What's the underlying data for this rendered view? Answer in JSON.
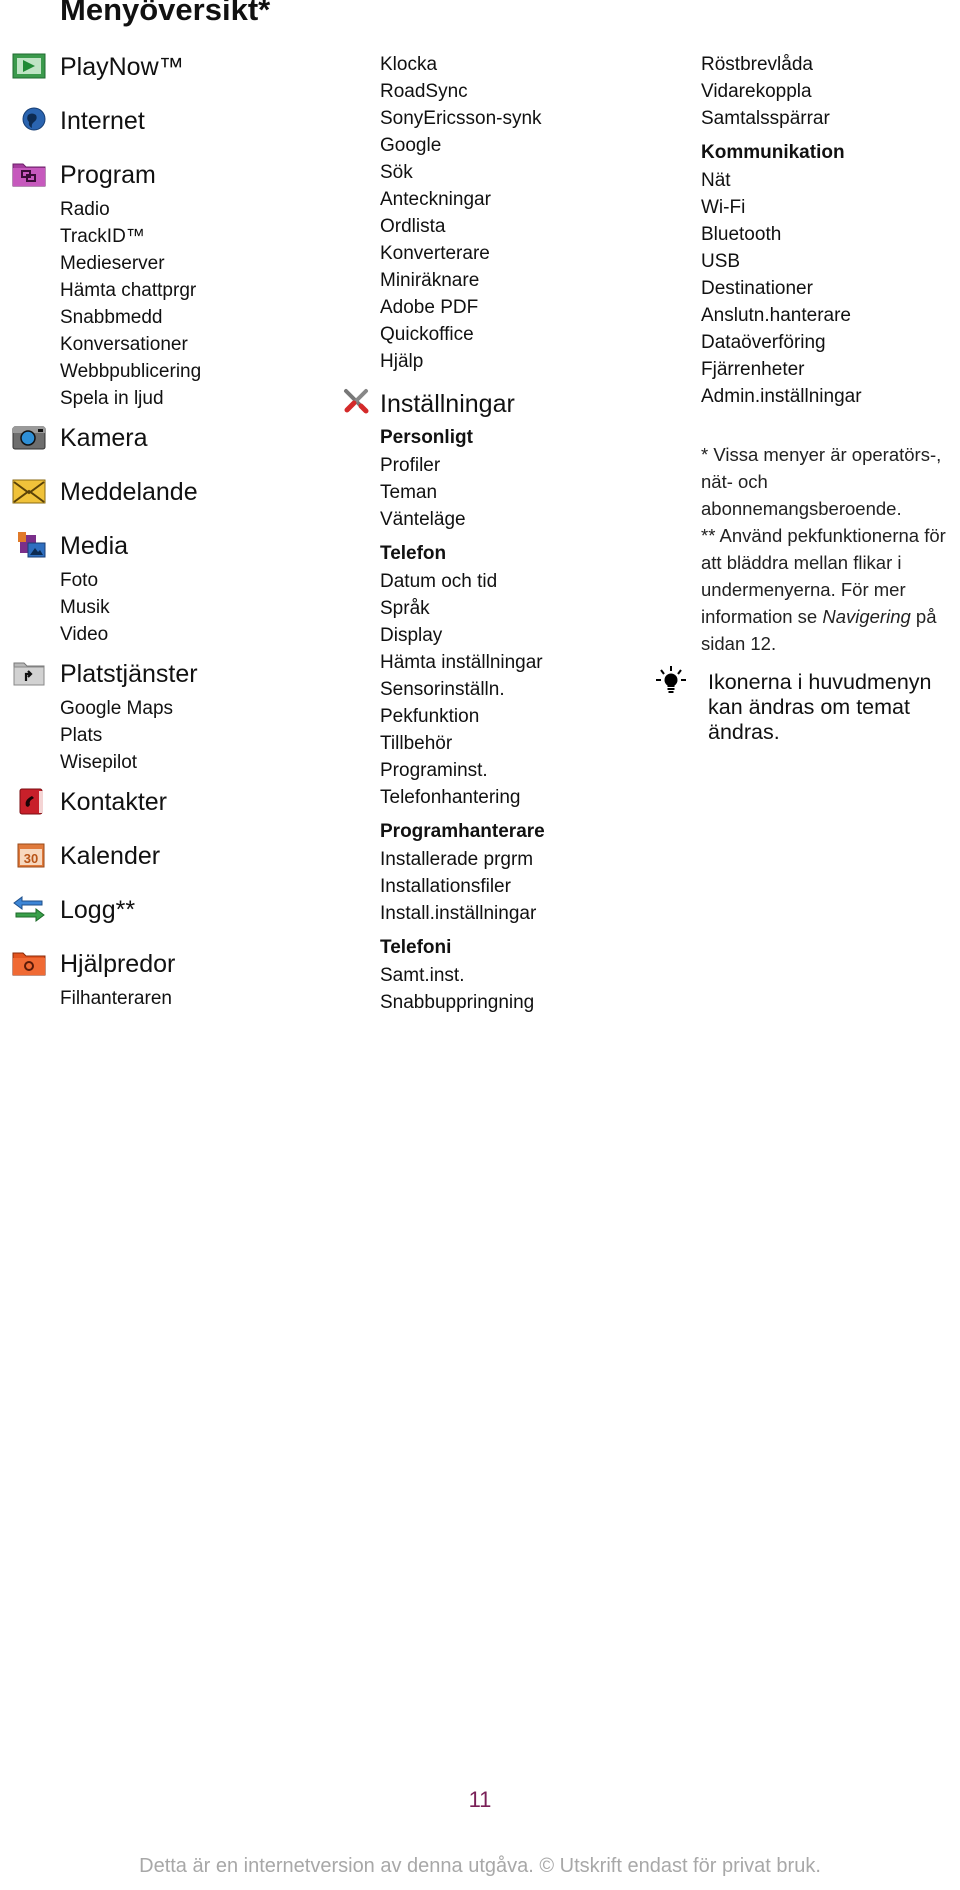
{
  "title": "Menyöversikt*",
  "col1": [
    {
      "label": "PlayNow™",
      "icon": "playnow-icon",
      "y": 0
    },
    {
      "label": "Internet",
      "icon": "globe-icon"
    },
    {
      "label": "Program",
      "icon": "program-folder-icon",
      "items": [
        "Radio",
        "TrackID™",
        "Medieserver",
        "Hämta chattprgr",
        "Snabbmedd",
        "Konversationer",
        "Webbpublicering",
        "Spela in ljud"
      ]
    },
    {
      "label": "Kamera",
      "icon": "camera-icon"
    },
    {
      "label": "Meddelande",
      "icon": "envelope-icon"
    },
    {
      "label": "Media",
      "icon": "media-icon",
      "items": [
        "Foto",
        "Musik",
        "Video"
      ]
    },
    {
      "label": "Platstjänster",
      "icon": "location-folder-icon",
      "items": [
        "Google Maps",
        "Plats",
        "Wisepilot"
      ]
    },
    {
      "label": "Kontakter",
      "icon": "contacts-icon"
    },
    {
      "label": "Kalender",
      "icon": "calendar-icon",
      "icon_text": "30"
    },
    {
      "label": "Logg**",
      "icon": "log-arrows-icon"
    },
    {
      "label": "Hjälpredor",
      "icon": "organizer-folder-icon",
      "items": [
        "Filhanteraren"
      ]
    }
  ],
  "col2": {
    "top_items": [
      "Klocka",
      "RoadSync",
      "SonyEricsson-synk",
      "Google",
      "Sök",
      "Anteckningar",
      "Ordlista",
      "Konverterare",
      "Miniräknare",
      "Adobe PDF",
      "Quickoffice",
      "Hjälp"
    ],
    "settings_label": "Inställningar",
    "groups": [
      {
        "name": "Personligt",
        "items": [
          "Profiler",
          "Teman",
          "Vänteläge"
        ]
      },
      {
        "name": "Telefon",
        "items": [
          "Datum och tid",
          "Språk",
          "Display",
          "Hämta inställningar",
          "Sensorinställn.",
          "Pekfunktion",
          "Tillbehör",
          "Programinst.",
          "Telefonhantering"
        ]
      },
      {
        "name": "Programhanterare",
        "items": [
          "Installerade prgrm",
          "Installationsfiler",
          "Install.inställningar"
        ]
      },
      {
        "name": "Telefoni",
        "items": [
          "Samt.inst.",
          "Snabbuppringning"
        ]
      }
    ]
  },
  "col3": {
    "top_items": [
      "Röstbrevlåda",
      "Vidarekoppla",
      "Samtalsspärrar"
    ],
    "groups": [
      {
        "name": "Kommunikation",
        "items": [
          "Nät",
          "Wi-Fi",
          "Bluetooth",
          "USB",
          "Destinationer",
          "Anslutn.hanterare",
          "Dataöverföring",
          "Fjärrenheter",
          "Admin.inställningar"
        ]
      }
    ],
    "footnotes": {
      "line1": "* Vissa menyer är operatörs-,",
      "line2": "nät- och",
      "line3": "abonnemangsberoende.",
      "line4": "** Använd pekfunktionerna för",
      "line5": "att bläddra mellan flikar i",
      "line6": "undermenyerna. För mer",
      "line7_pre": "information se ",
      "line7_em": "Navigering",
      "line7_post": " på",
      "line8": "sidan 12."
    },
    "tip": {
      "line1": "Ikonerna i huvudmenyn",
      "line2": "kan ändras om temat",
      "line3": "ändras."
    }
  },
  "page_number": "11",
  "footer": "Detta är en internetversion av denna utgåva. © Utskrift endast för privat bruk.",
  "colors": {
    "page_number": "#7a1f57",
    "footer": "#a8a8a8"
  }
}
